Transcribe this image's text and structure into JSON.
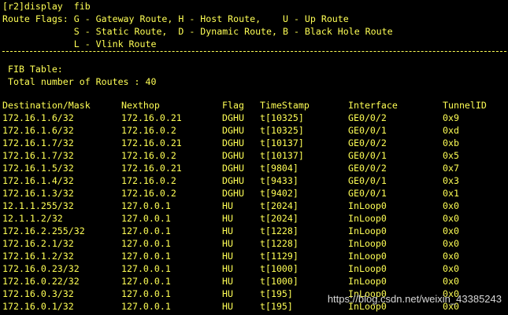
{
  "terminal": {
    "command_line": "[r2]display  fib",
    "flags_line1": "Route Flags: G - Gateway Route, H - Host Route,    U - Up Route",
    "flags_line2": "             S - Static Route,  D - Dynamic Route, B - Black Hole Route",
    "flags_line3": "             L - Vlink Route",
    "fib_title": " FIB Table:",
    "total_routes": " Total number of Routes : 40",
    "columns": {
      "destination": "Destination/Mask",
      "nexthop": "Nexthop",
      "flag": "Flag",
      "timestamp": "TimeStamp",
      "interface": "Interface",
      "tunnel": "TunnelID"
    },
    "rows": [
      {
        "dest": "172.16.1.6/32",
        "next": "172.16.0.21",
        "flag": "DGHU",
        "time": "t[10325]",
        "intf": "GE0/0/2",
        "tun": "0x9"
      },
      {
        "dest": "172.16.1.6/32",
        "next": "172.16.0.2",
        "flag": "DGHU",
        "time": "t[10325]",
        "intf": "GE0/0/1",
        "tun": "0xd"
      },
      {
        "dest": "172.16.1.7/32",
        "next": "172.16.0.21",
        "flag": "DGHU",
        "time": "t[10137]",
        "intf": "GE0/0/2",
        "tun": "0xb"
      },
      {
        "dest": "172.16.1.7/32",
        "next": "172.16.0.2",
        "flag": "DGHU",
        "time": "t[10137]",
        "intf": "GE0/0/1",
        "tun": "0x5"
      },
      {
        "dest": "172.16.1.5/32",
        "next": "172.16.0.21",
        "flag": "DGHU",
        "time": "t[9804]",
        "intf": "GE0/0/2",
        "tun": "0x7"
      },
      {
        "dest": "172.16.1.4/32",
        "next": "172.16.0.2",
        "flag": "DGHU",
        "time": "t[9433]",
        "intf": "GE0/0/1",
        "tun": "0x3"
      },
      {
        "dest": "172.16.1.3/32",
        "next": "172.16.0.2",
        "flag": "DGHU",
        "time": "t[9402]",
        "intf": "GE0/0/1",
        "tun": "0x1"
      },
      {
        "dest": "12.1.1.255/32",
        "next": "127.0.0.1",
        "flag": "HU",
        "time": "t[2024]",
        "intf": "InLoop0",
        "tun": "0x0"
      },
      {
        "dest": "12.1.1.2/32",
        "next": "127.0.0.1",
        "flag": "HU",
        "time": "t[2024]",
        "intf": "InLoop0",
        "tun": "0x0"
      },
      {
        "dest": "172.16.2.255/32",
        "next": "127.0.0.1",
        "flag": "HU",
        "time": "t[1228]",
        "intf": "InLoop0",
        "tun": "0x0"
      },
      {
        "dest": "172.16.2.1/32",
        "next": "127.0.0.1",
        "flag": "HU",
        "time": "t[1228]",
        "intf": "InLoop0",
        "tun": "0x0"
      },
      {
        "dest": "172.16.1.2/32",
        "next": "127.0.0.1",
        "flag": "HU",
        "time": "t[1129]",
        "intf": "InLoop0",
        "tun": "0x0"
      },
      {
        "dest": "172.16.0.23/32",
        "next": "127.0.0.1",
        "flag": "HU",
        "time": "t[1000]",
        "intf": "InLoop0",
        "tun": "0x0"
      },
      {
        "dest": "172.16.0.22/32",
        "next": "127.0.0.1",
        "flag": "HU",
        "time": "t[1000]",
        "intf": "InLoop0",
        "tun": "0x0"
      },
      {
        "dest": "172.16.0.3/32",
        "next": "127.0.0.1",
        "flag": "HU",
        "time": "t[195]",
        "intf": "InLoop0",
        "tun": "0x0"
      },
      {
        "dest": "172.16.0.1/32",
        "next": "127.0.0.1",
        "flag": "HU",
        "time": "t[195]",
        "intf": "InLoop0",
        "tun": "0x0"
      }
    ]
  },
  "watermark": "https://blog.csdn.net/weixin_43385243",
  "colors": {
    "background": "#000000",
    "text": "#ffff55",
    "watermark": "#d9d9d9"
  }
}
